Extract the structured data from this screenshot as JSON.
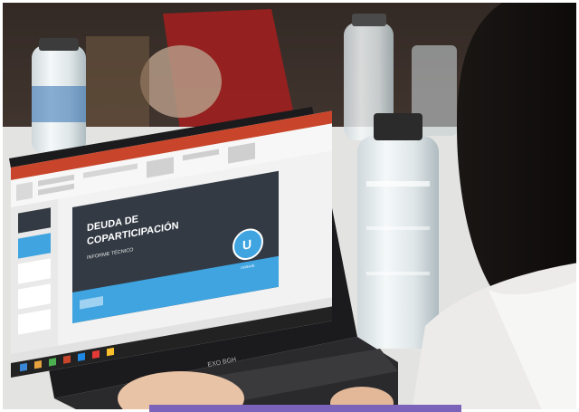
{
  "photo": {
    "slide_title_line1": "DEUDA DE",
    "slide_title_line2": "COPARTICIPACIÓN",
    "slide_subtitle": "INFORME TÉCNICO",
    "logo_letter": "U",
    "logo_caption": "UNSAJE",
    "laptop_brand": "EXO BGH"
  },
  "colors": {
    "ppt_orange": "#c8452b",
    "slide_dark": "#333a44",
    "slide_blue": "#3fa4e0",
    "accent_bar": "#7a63b8"
  }
}
